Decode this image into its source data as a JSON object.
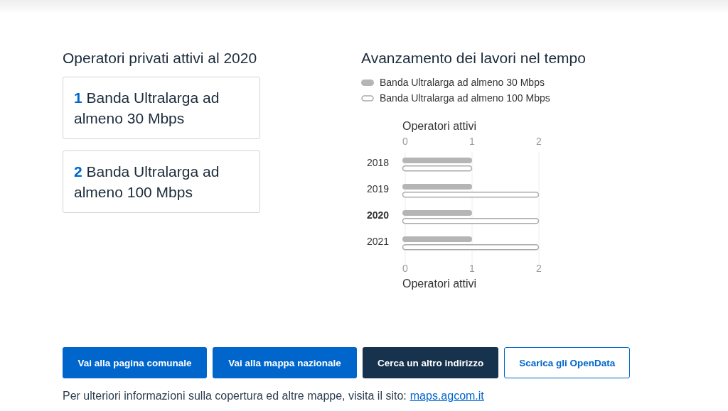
{
  "operators": {
    "title": "Operatori privati attivi al 2020",
    "cards": [
      {
        "count": "1",
        "label": "Banda Ultralarga ad almeno 30 Mbps"
      },
      {
        "count": "2",
        "label": "Banda Ultralarga ad almeno 100 Mbps"
      }
    ]
  },
  "progress": {
    "title": "Avanzamento dei lavori nel tempo",
    "legend": [
      {
        "kind": "filled"
      },
      {
        "kind": "outline"
      }
    ],
    "year_rows": [
      {
        "selected": false
      },
      {
        "selected": false
      },
      {
        "selected": true
      },
      {
        "selected": false
      }
    ],
    "bottom_axis": {
      "title": "Operatori attivi",
      "ticks": [
        "0",
        "1",
        "2"
      ]
    },
    "chart_data": {
      "type": "bar",
      "orientation": "horizontal",
      "xlabel": "Operatori attivi",
      "categories": [
        "2018",
        "2019",
        "2020",
        "2021"
      ],
      "xlim": [
        0,
        2
      ],
      "xticks": [
        0,
        1,
        2
      ],
      "series": [
        {
          "name": "Banda Ultralarga ad almeno 30 Mbps",
          "color": "#b5b5b5",
          "values": [
            1,
            1,
            1,
            1
          ]
        },
        {
          "name": "Banda Ultralarga ad almeno 100 Mbps",
          "color": "#ffffff",
          "values": [
            1,
            2,
            2,
            2
          ]
        }
      ]
    }
  },
  "buttons": [
    {
      "label": "Vai alla pagina comunale",
      "kind": "primary"
    },
    {
      "label": "Vai alla mappa nazionale",
      "kind": "primary"
    },
    {
      "label": "Cerca un altro indirizzo",
      "kind": "dark"
    },
    {
      "label": "Scarica gli OpenData",
      "kind": "outline"
    }
  ],
  "footer": {
    "text": "Per ulteriori informazioni sulla copertura ed altre mappe, visita il sito:",
    "link": "maps.agcom.it"
  }
}
